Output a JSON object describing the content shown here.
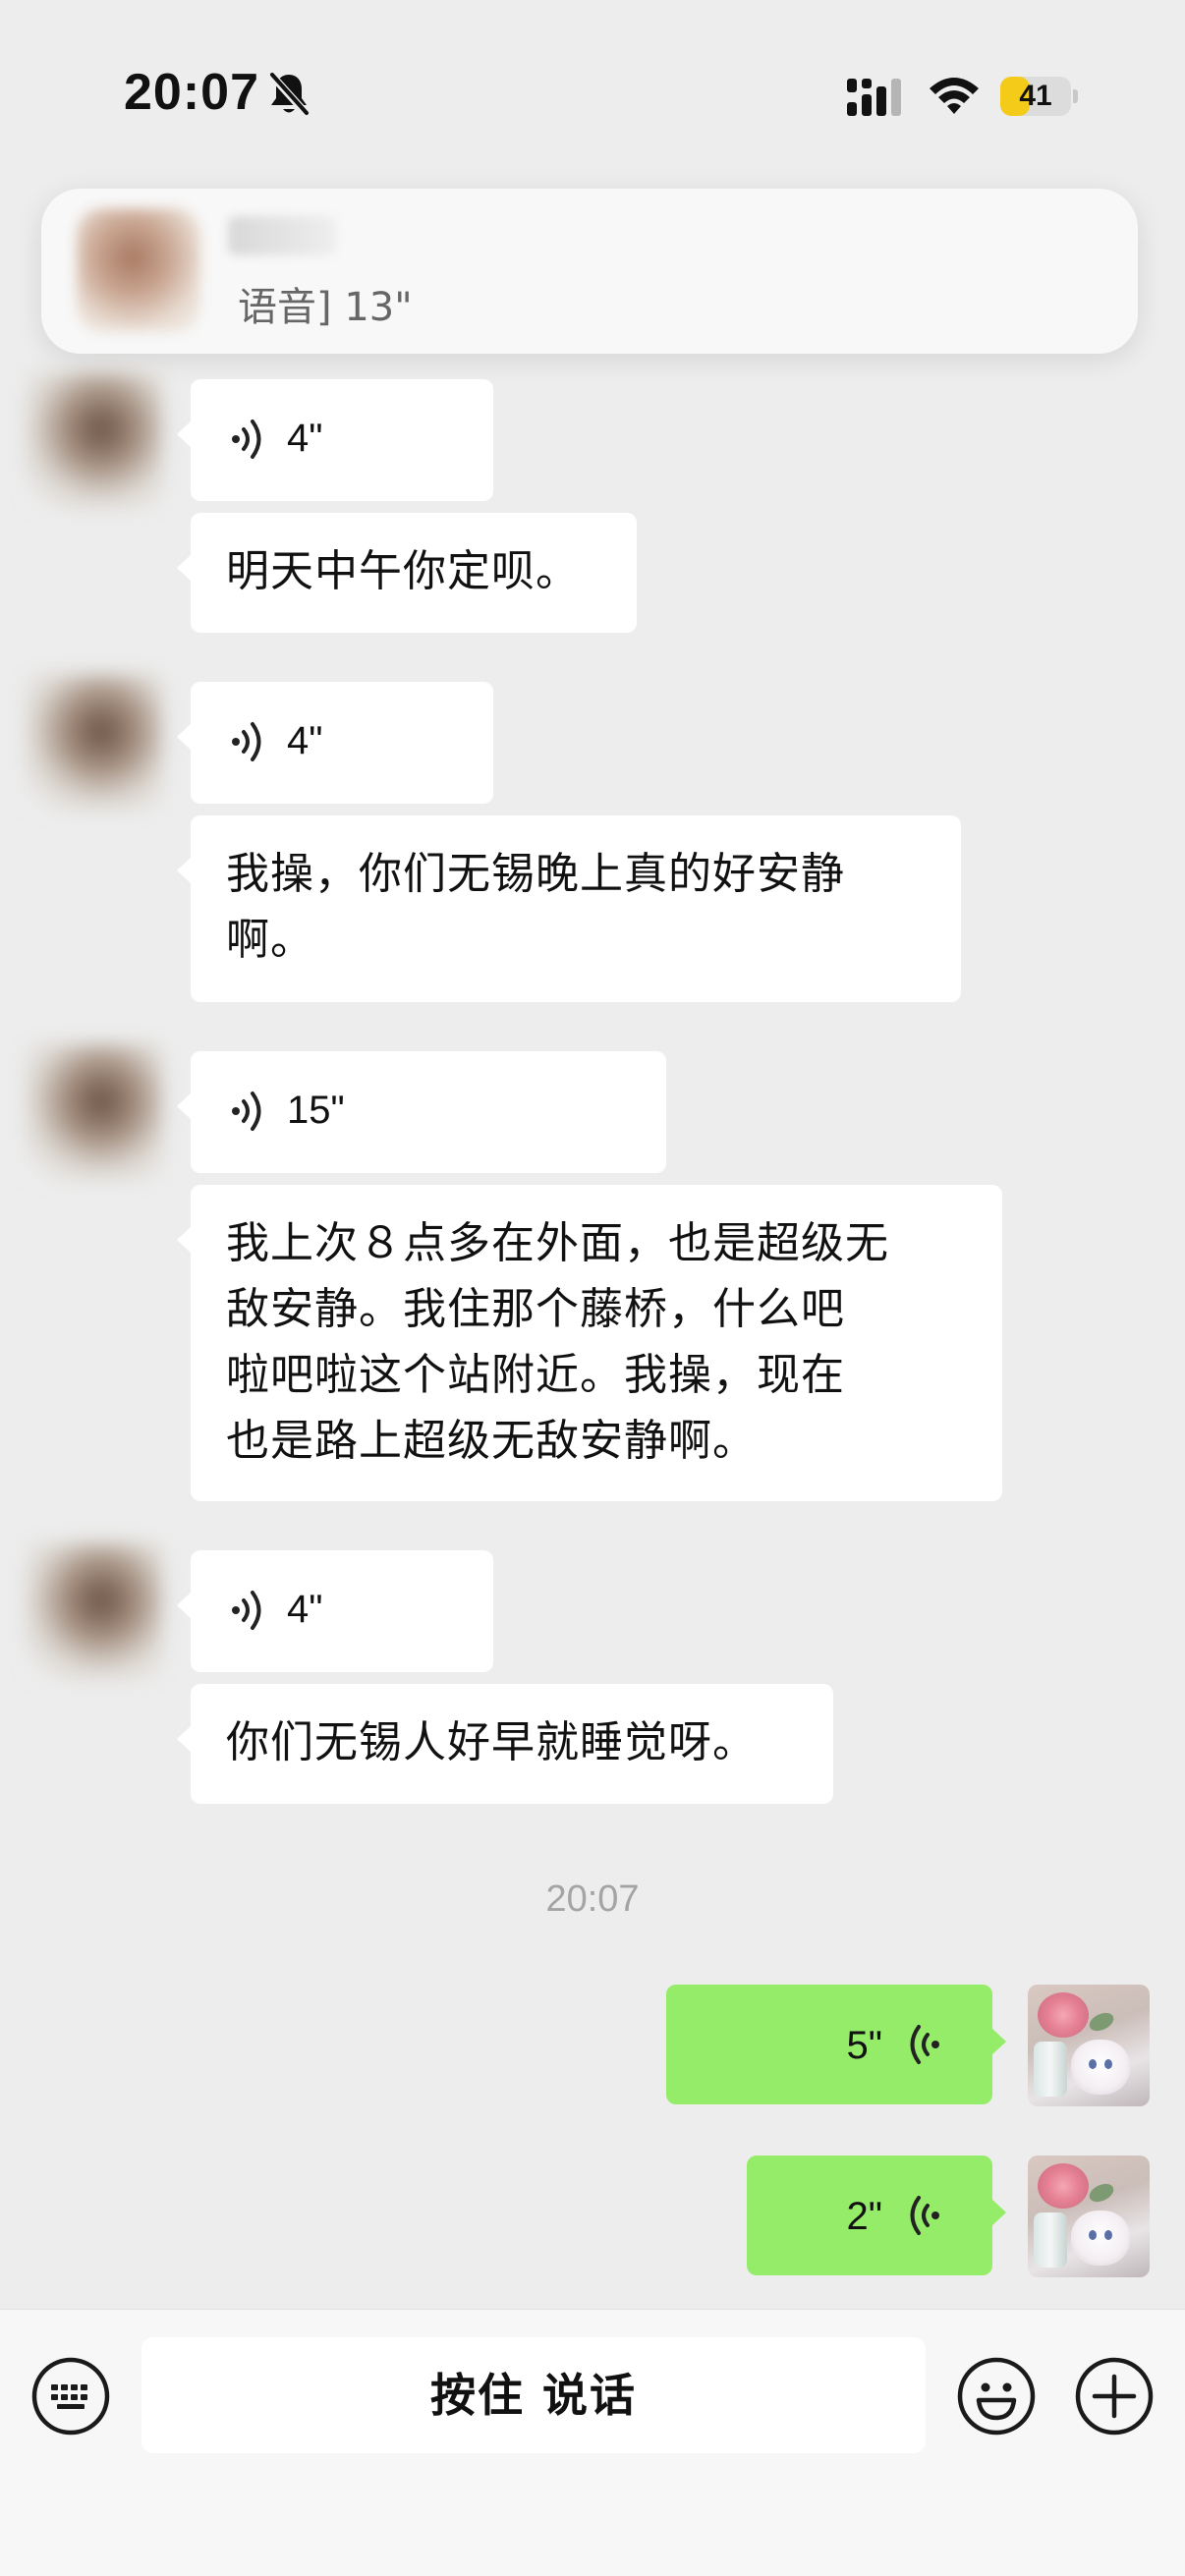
{
  "status_bar": {
    "time": "20:07",
    "battery_level": "41",
    "battery_fraction": 0.41,
    "icons": [
      "bell-slash-icon",
      "cellular-signal-icon",
      "wifi-icon",
      "battery-icon"
    ]
  },
  "notification": {
    "preview": "语音] 13\""
  },
  "messages": [
    {
      "direction": "in",
      "type": "voice",
      "duration": "4\""
    },
    {
      "direction": "in",
      "type": "text",
      "lines": [
        "明天中午你定呗。"
      ]
    },
    {
      "direction": "in",
      "type": "voice",
      "duration": "4\""
    },
    {
      "direction": "in",
      "type": "text",
      "lines": [
        "我操，你们无锡晚上真的好安静",
        "啊。"
      ]
    },
    {
      "direction": "in",
      "type": "voice",
      "duration": "15\""
    },
    {
      "direction": "in",
      "type": "text",
      "lines": [
        "我上次８点多在外面，也是超级无",
        "敌安静。我住那个藤桥，什么吧",
        "啦吧啦这个站附近。我操，现在",
        "也是路上超级无敌安静啊。"
      ]
    },
    {
      "direction": "in",
      "type": "voice",
      "duration": "4\""
    },
    {
      "direction": "in",
      "type": "text",
      "lines": [
        "你们无锡人好早就睡觉呀。"
      ]
    },
    {
      "direction": "out",
      "type": "voice",
      "duration": "5\""
    },
    {
      "direction": "out",
      "type": "voice",
      "duration": "2\""
    }
  ],
  "timestamp": "20:07",
  "input_bar": {
    "hold_to_talk": "按住 说话",
    "icons": [
      "keyboard-icon",
      "emoji-icon",
      "plus-icon"
    ]
  },
  "colors": {
    "background": "#ededed",
    "incoming_bubble": "#ffffff",
    "outgoing_bubble": "#95ec69",
    "battery": "#f5cb1a"
  }
}
